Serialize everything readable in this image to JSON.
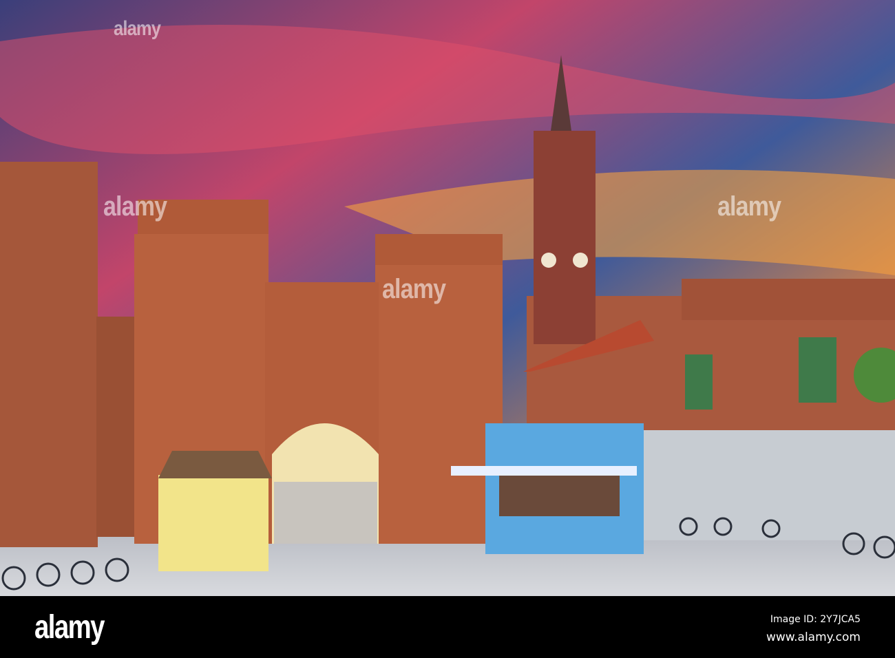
{
  "watermark": "alamy",
  "footer": {
    "logo": "alamy",
    "image_id": "Image ID: 2Y7JCA5",
    "website": "www.alamy.com"
  },
  "colors": {
    "sky_top": "#2c3a6e",
    "sky_sunset": "#f08a3a",
    "brick": "#b8613e",
    "stall": "#5aa8e0"
  }
}
